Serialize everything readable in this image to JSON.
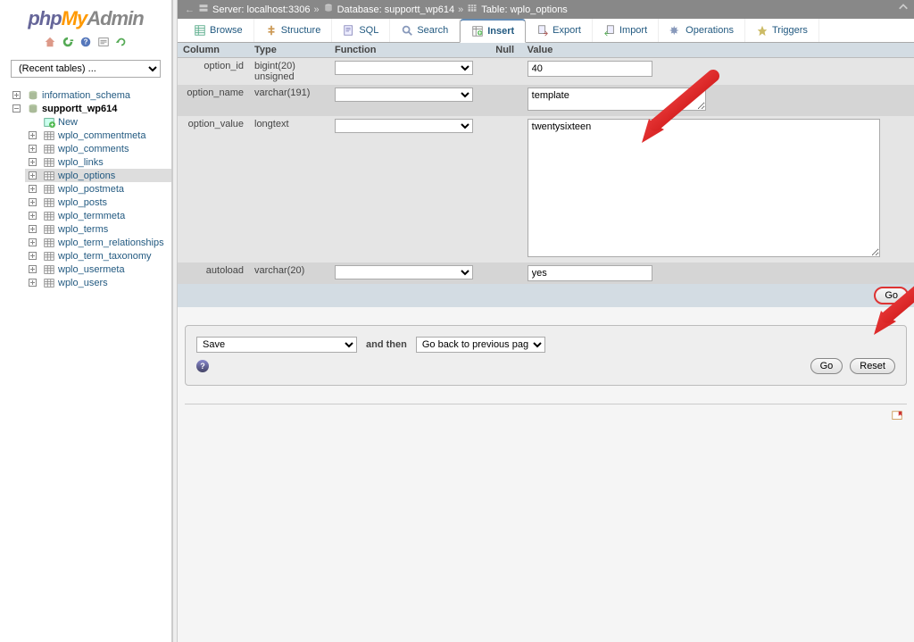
{
  "logo": {
    "p1": "php",
    "p2": "My",
    "p3": "Admin"
  },
  "recent_placeholder": "(Recent tables) ...",
  "tree": {
    "db1": "information_schema",
    "db2": "supportt_wp614",
    "new": "New",
    "tables": [
      "wplo_commentmeta",
      "wplo_comments",
      "wplo_links",
      "wplo_options",
      "wplo_postmeta",
      "wplo_posts",
      "wplo_termmeta",
      "wplo_terms",
      "wplo_term_relationships",
      "wplo_term_taxonomy",
      "wplo_usermeta",
      "wplo_users"
    ],
    "selected": "wplo_options"
  },
  "breadcrumb": {
    "server_lbl": "Server: localhost:3306",
    "db_lbl": "Database: supportt_wp614",
    "tbl_lbl": "Table: wplo_options",
    "sep": "»"
  },
  "tabs": {
    "browse": "Browse",
    "structure": "Structure",
    "sql": "SQL",
    "search": "Search",
    "insert": "Insert",
    "export": "Export",
    "import": "Import",
    "operations": "Operations",
    "triggers": "Triggers"
  },
  "headers": {
    "column": "Column",
    "type": "Type",
    "function": "Function",
    "null": "Null",
    "value": "Value"
  },
  "rows": {
    "r1": {
      "col": "option_id",
      "type": "bigint(20) unsigned",
      "val": "40"
    },
    "r2": {
      "col": "option_name",
      "type": "varchar(191)",
      "val": "template"
    },
    "r3": {
      "col": "option_value",
      "type": "longtext",
      "val": "twentysixteen"
    },
    "r4": {
      "col": "autoload",
      "type": "varchar(20)",
      "val": "yes"
    }
  },
  "buttons": {
    "go": "Go",
    "reset": "Reset"
  },
  "after": {
    "save": "Save",
    "andthen": "and then",
    "goback": "Go back to previous page"
  }
}
